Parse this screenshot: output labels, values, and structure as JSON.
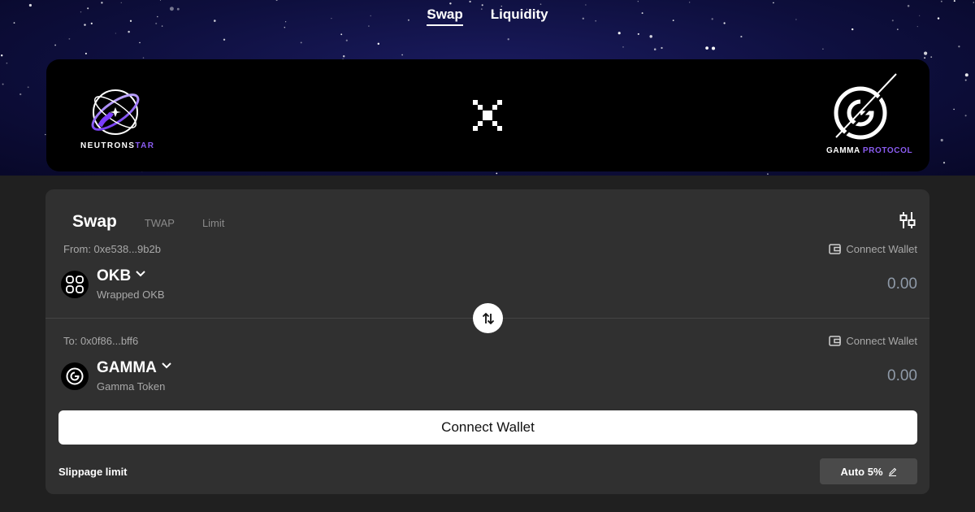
{
  "nav": {
    "tabs": [
      {
        "label": "Swap"
      },
      {
        "label": "Liquidity"
      }
    ]
  },
  "banner": {
    "left_brand_main": "NEUTRONS",
    "left_brand_accent": "TAR",
    "right_brand_main": "GAMMA",
    "right_brand_accent": "PROTOCOL",
    "accent_color": "#8a5cf0"
  },
  "swap": {
    "title": "Swap",
    "tabs": [
      "TWAP",
      "Limit"
    ],
    "from": {
      "label": "From: 0xe538...9b2b",
      "connect_label": "Connect Wallet",
      "symbol": "OKB",
      "name": "Wrapped OKB",
      "amount": "0.00",
      "icon": "okb-icon"
    },
    "to": {
      "label": "To: 0x0f86...bff6",
      "connect_label": "Connect Wallet",
      "symbol": "GAMMA",
      "name": "Gamma Token",
      "amount": "0.00",
      "icon": "gamma-token-icon"
    },
    "connect_button": "Connect Wallet",
    "slippage_label": "Slippage limit",
    "slippage_value": "Auto 5%"
  }
}
